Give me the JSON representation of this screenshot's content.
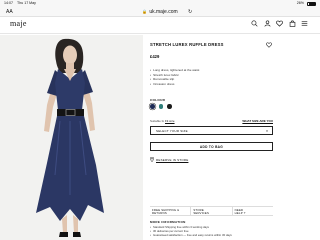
{
  "status_bar": {
    "time": "14:07",
    "date": "Thu 17 May",
    "battery": "26%"
  },
  "browser": {
    "aa": "AA",
    "url": "uk.maje.com"
  },
  "header": {
    "logo": "maje"
  },
  "product": {
    "title": "STRETCH LUREX RUFFLE DRESS",
    "price": "£429",
    "features": [
      "Long dress, tightened at the waist",
      "Stretch lurex fabric",
      "Removable slip",
      "Occasion dress"
    ],
    "colour_label": "COLOUR",
    "colours": [
      "#1e2b55",
      "#2f7f7a",
      "#1b1b1b"
    ],
    "selected_colour": 0,
    "fit_prefix": "Suitable fo ",
    "fit_value": "Fit size",
    "size_guide": "WHAT SIZE ARE YOU",
    "select_size": "SELECT YOUR SIZE",
    "add_to_bag": "ADD TO BAG",
    "reserve": "RESERVE IN STORE"
  },
  "services": [
    {
      "line1": "FREE SHIPPING &",
      "line2": "RETURNS"
    },
    {
      "line1": "STORE",
      "line2": "SERVICES"
    },
    {
      "line1": "NEED",
      "line2": "HELP ?"
    }
  ],
  "more_info": {
    "title": "MORE INFORMATION",
    "items": [
      "Standard Shipping free within 3 working days",
      "30 deliveries per current free",
      "Guaranteed satisfaction — free and easy returns within 30 days"
    ]
  },
  "icons": {
    "search": "search-icon",
    "account": "account-icon",
    "wishlist": "heart-icon",
    "bag": "bag-icon",
    "menu": "menu-icon"
  }
}
